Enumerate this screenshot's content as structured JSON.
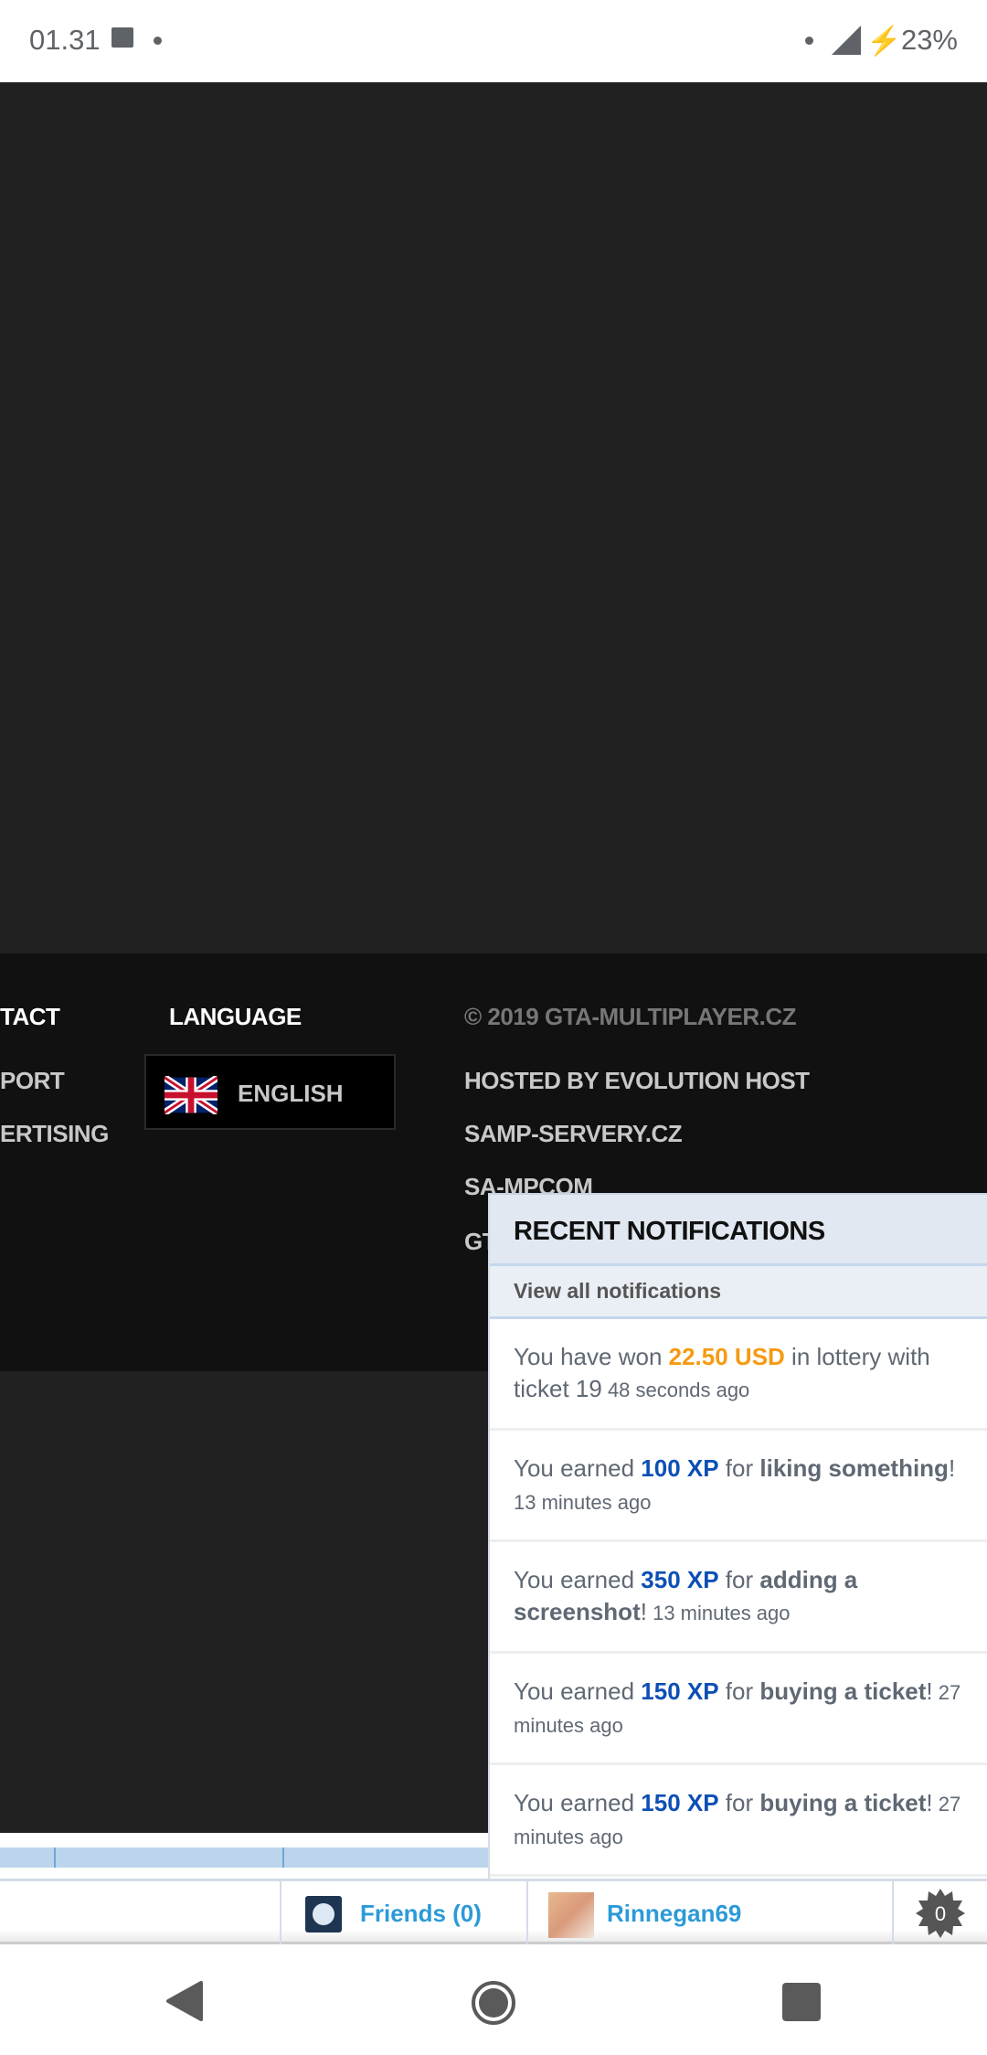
{
  "status_bar": {
    "time": "01.31",
    "battery": "23%"
  },
  "footer": {
    "contact_heading": "TACT",
    "contact_links": [
      "PORT",
      "ERTISING"
    ],
    "language_heading": "LANGUAGE",
    "language_selected": "ENGLISH",
    "copyright": "© 2019 GTA-MULTIPLAYER.CZ",
    "links": [
      "HOSTED BY EVOLUTION HOST",
      "SAMP-SERVERY.CZ",
      "SA-MPCOM",
      "GT"
    ]
  },
  "notifications": {
    "title": "RECENT NOTIFICATIONS",
    "view_all": "View all notifications",
    "items": [
      {
        "pre": "You have won ",
        "value": "22.50 USD",
        "mid": " in lottery with ticket 19",
        "bold": "",
        "post": "",
        "time": " 48 seconds ago"
      },
      {
        "pre": "You earned ",
        "value": "100 XP",
        "mid": " for ",
        "bold": "liking something",
        "post": "!",
        "time": " 13 minutes ago"
      },
      {
        "pre": "You earned ",
        "value": "350 XP",
        "mid": " for ",
        "bold": "adding a screenshot",
        "post": "!",
        "time": " 13 minutes ago"
      },
      {
        "pre": "You earned ",
        "value": "150 XP",
        "mid": " for ",
        "bold": "buying a ticket",
        "post": "!",
        "time": " 27 minutes ago"
      },
      {
        "pre": "You earned ",
        "value": "150 XP",
        "mid": " for ",
        "bold": "buying a ticket",
        "post": "!",
        "time": " 27 minutes ago"
      }
    ]
  },
  "bottom_bar": {
    "friends": "Friends (0)",
    "username": "Rinnegan69",
    "notification_count": "0"
  },
  "colors": {
    "usd": "#f59a12",
    "xp": "#0d4fb5",
    "link": "#2b9ad8"
  }
}
